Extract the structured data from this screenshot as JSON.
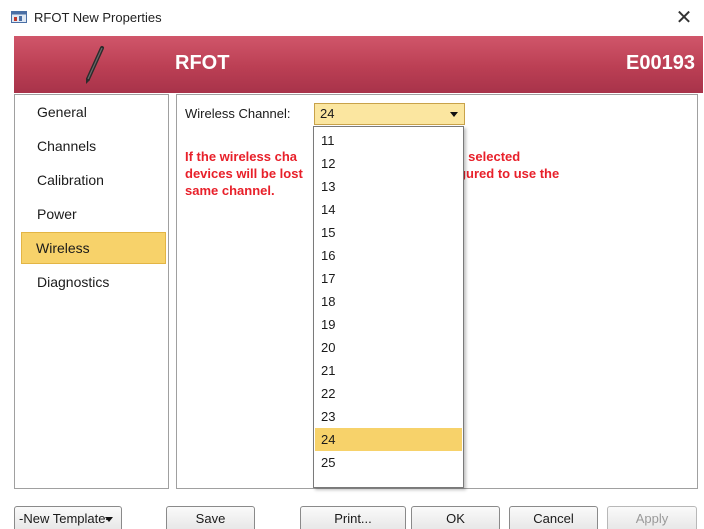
{
  "window": {
    "title": "RFOT New Properties",
    "close_symbol": "✕"
  },
  "banner": {
    "title": "RFOT",
    "device_id": "E00193",
    "icon": "pen-icon",
    "color": "#bb3f54"
  },
  "nav": {
    "items": [
      "General",
      "Channels",
      "Calibration",
      "Power",
      "Wireless",
      "Diagnostics"
    ],
    "selected": "Wireless"
  },
  "wireless": {
    "channel_label": "Wireless Channel:",
    "channel_value": "24",
    "warning_line1": "If the wireless cha              munication with all selected",
    "warning_line2": "devices will be lost              RFC1000 is configured to use the",
    "warning_line3": "same channel.",
    "warning_color": "#e8202a",
    "options": [
      "11",
      "12",
      "13",
      "14",
      "15",
      "16",
      "17",
      "18",
      "19",
      "20",
      "21",
      "22",
      "23",
      "24",
      "25"
    ],
    "selected_option": "24",
    "highlight_color": "#f7d26a"
  },
  "footer": {
    "template_select": "-New Template-",
    "save": "Save",
    "print": "Print...",
    "ok": "OK",
    "cancel": "Cancel",
    "apply": "Apply"
  }
}
